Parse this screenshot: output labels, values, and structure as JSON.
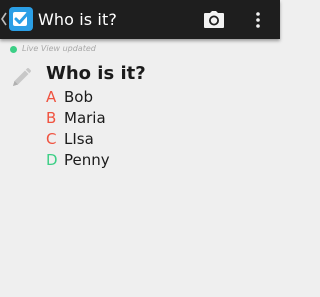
{
  "appbar": {
    "title": "Who is it?",
    "icons": [
      "back-chevron-icon",
      "app-checkbox-icon",
      "camera-icon",
      "overflow-menu-icon"
    ]
  },
  "status": {
    "text": "Live View updated",
    "dot_color": "#3ccf86"
  },
  "question": {
    "title": "Who is it?",
    "edit_icon": "pencil-icon"
  },
  "answers": [
    {
      "letter": "A",
      "name": "Bob",
      "letter_color": "#f0523f"
    },
    {
      "letter": "B",
      "name": "Maria",
      "letter_color": "#f0523f"
    },
    {
      "letter": "C",
      "name": "LIsa",
      "letter_color": "#f0523f"
    },
    {
      "letter": "D",
      "name": "Penny",
      "letter_color": "#3ccf86"
    }
  ],
  "colors": {
    "appbar_bg": "#1e1e1e",
    "page_bg": "#efefef",
    "accent_blue": "#2b9fe6"
  }
}
